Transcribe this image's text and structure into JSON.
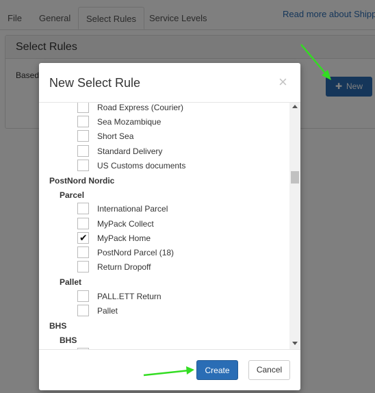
{
  "tabs": [
    {
      "label": "File"
    },
    {
      "label": "General"
    },
    {
      "label": "Select Rules"
    },
    {
      "label": "Service Levels"
    }
  ],
  "header": {
    "read_more": "Read more about Shippin"
  },
  "panel": {
    "title": "Select Rules",
    "based_text": "Based",
    "new_button": "New"
  },
  "modal": {
    "title": "New Select Rule",
    "close": "×",
    "create_label": "Create",
    "cancel_label": "Cancel",
    "rows": [
      {
        "type": "opt",
        "label": "Road Express (Courier)",
        "checked": false
      },
      {
        "type": "opt",
        "label": "Sea Mozambique",
        "checked": false
      },
      {
        "type": "opt",
        "label": "Short Sea",
        "checked": false
      },
      {
        "type": "opt",
        "label": "Standard Delivery",
        "checked": false
      },
      {
        "type": "opt",
        "label": "US Customs documents",
        "checked": false
      },
      {
        "type": "group",
        "label": "PostNord Nordic"
      },
      {
        "type": "sub",
        "label": "Parcel"
      },
      {
        "type": "opt",
        "label": "International Parcel",
        "checked": false
      },
      {
        "type": "opt",
        "label": "MyPack Collect",
        "checked": false
      },
      {
        "type": "opt",
        "label": "MyPack Home",
        "checked": true
      },
      {
        "type": "opt",
        "label": "PostNord Parcel (18)",
        "checked": false
      },
      {
        "type": "opt",
        "label": "Return Dropoff",
        "checked": false
      },
      {
        "type": "sub",
        "label": "Pallet"
      },
      {
        "type": "opt",
        "label": "PALL.ETT Return",
        "checked": false
      },
      {
        "type": "opt",
        "label": "Pallet",
        "checked": false
      },
      {
        "type": "group",
        "label": "BHS"
      },
      {
        "type": "sub",
        "label": "BHS"
      },
      {
        "type": "opt",
        "label": "",
        "checked": false
      }
    ]
  },
  "colors": {
    "primary": "#2a6db5",
    "annotation_arrow": "#33dd22"
  }
}
